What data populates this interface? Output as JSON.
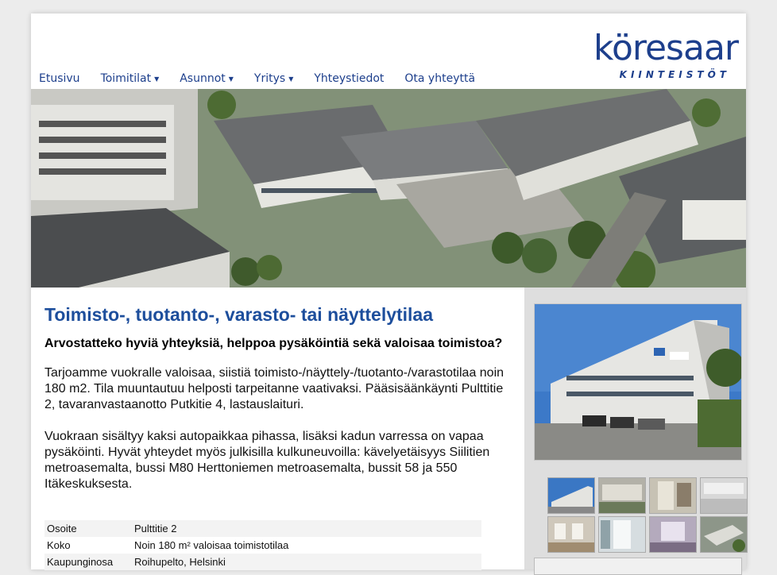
{
  "brand": {
    "name": "köresaar",
    "tagline": "KIINTEISTÖT",
    "color": "#1d3f8c"
  },
  "nav": {
    "items": [
      {
        "label": "Etusivu",
        "dropdown": false
      },
      {
        "label": "Toimitilat",
        "dropdown": true
      },
      {
        "label": "Asunnot",
        "dropdown": true
      },
      {
        "label": "Yritys",
        "dropdown": true
      },
      {
        "label": "Yhteystiedot",
        "dropdown": false
      },
      {
        "label": "Ota yhteyttä",
        "dropdown": false
      }
    ]
  },
  "main": {
    "title": "Toimisto-, tuotanto-, varasto- tai näyttelytilaa",
    "lead": "Arvostatteko hyviä yhteyksiä, helppoa pysäköintiä sekä valoisaa toimistoa?",
    "paragraph1": "Tarjoamme vuokralle valoisaa, siistiä toimisto-/näyttely-/tuotanto-/varastotilaa noin 180 m2. Tila muuntautuu helposti tarpeitanne vaativaksi. Pääsisäänkäynti Pulttitie 2, tavaranvastaanotto Putkitie 4, lastauslaituri.",
    "paragraph2": "Vuokraan sisältyy kaksi autopaikkaa pihassa, lisäksi kadun varressa on vapaa pysäköinti. Hyvät yhteydet myös julkisilla kulkuneuvoilla: kävelyetäisyys Siilitien metroasemalta, bussi M80 Herttoniemen metroasemalta, bussit 58 ja 550 Itäkeskuksesta."
  },
  "info": {
    "rows": [
      {
        "key": "Osoite",
        "value": "Pulttitie 2"
      },
      {
        "key": "Koko",
        "value": "Noin 180 m² valoisaa toimistotilaa"
      },
      {
        "key": "Kaupunginosa",
        "value": "Roihupelto, Helsinki"
      }
    ]
  },
  "gallery": {
    "thumbnail_count": 8,
    "icon": "photo-gallery"
  }
}
